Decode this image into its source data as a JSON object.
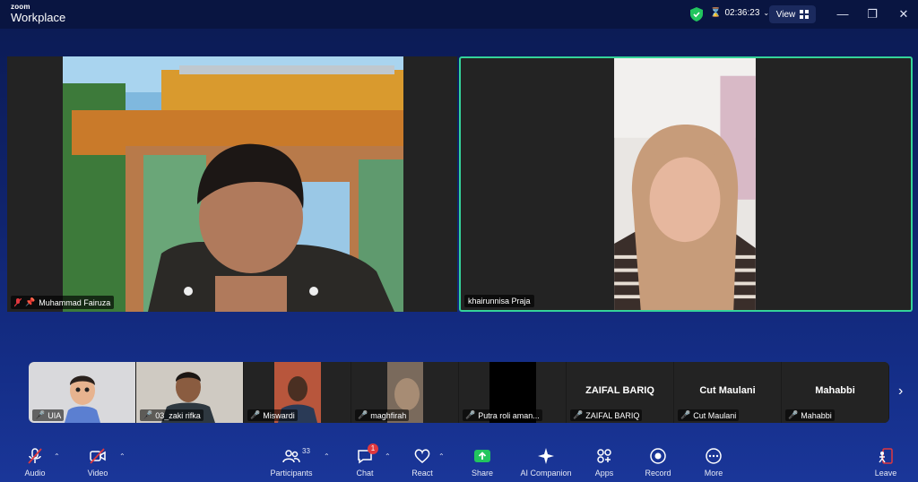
{
  "app": {
    "brand_top": "zoom",
    "brand_bottom": "Workplace"
  },
  "titlebar": {
    "timer": "02:36:23",
    "view_label": "View"
  },
  "main_tiles": [
    {
      "name": "Muhammad Fairuza",
      "muted": true,
      "pinned": true
    },
    {
      "name": "khairunnisa Praja",
      "active_speaker": true
    }
  ],
  "participants_strip": [
    {
      "name": "UIA",
      "type": "avatar"
    },
    {
      "name": "03_zaki rifka",
      "type": "video"
    },
    {
      "name": "Miswardi",
      "type": "video"
    },
    {
      "name": "maghfirah",
      "type": "video"
    },
    {
      "name": "Putra roli aman...",
      "type": "video"
    },
    {
      "name": "ZAIFAL BARIQ",
      "display": "ZAIFAL BARIQ",
      "type": "name"
    },
    {
      "name": "Cut Maulani",
      "display": "Cut Maulani",
      "type": "name"
    },
    {
      "name": "Mahabbi",
      "display": "Mahabbi",
      "type": "name"
    }
  ],
  "toolbar": {
    "audio": "Audio",
    "video": "Video",
    "participants": "Participants",
    "participants_count": "33",
    "chat": "Chat",
    "chat_badge": "1",
    "react": "React",
    "share": "Share",
    "ai_companion": "AI Companion",
    "apps": "Apps",
    "record": "Record",
    "more": "More",
    "leave": "Leave"
  },
  "colors": {
    "active_border": "#34d399",
    "share_green": "#22c55e",
    "muted_red": "#e0383e",
    "background": "#0f1f5c"
  }
}
